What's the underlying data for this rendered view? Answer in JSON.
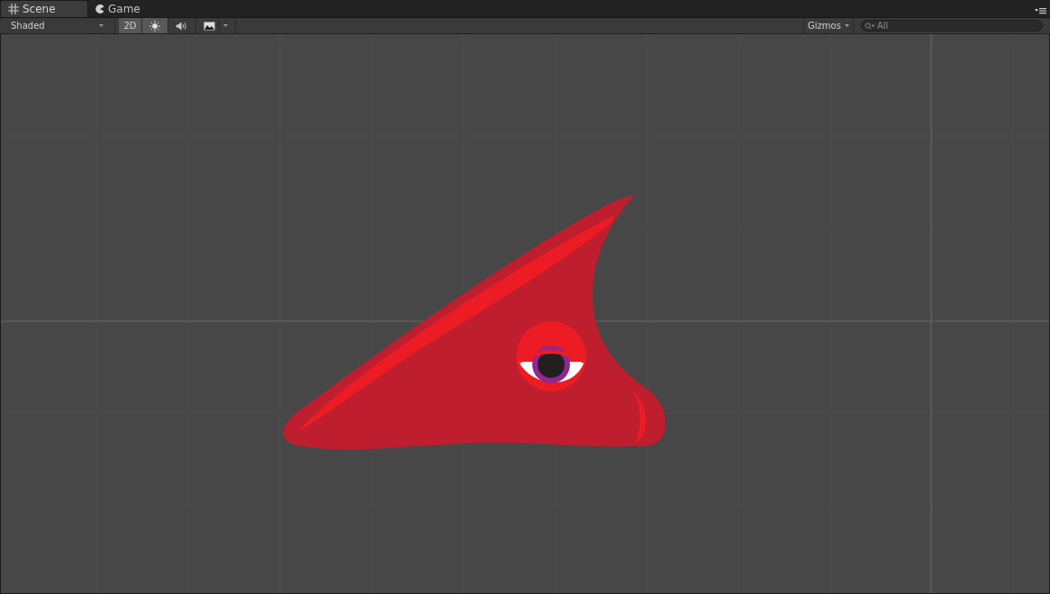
{
  "tabs": [
    {
      "label": "Scene",
      "kind": "scene",
      "selected": true
    },
    {
      "label": "Game",
      "kind": "game",
      "selected": false
    }
  ],
  "toolbar": {
    "shading": "Shaded",
    "toggles": [
      {
        "kind": "dimension",
        "label": "2D",
        "on": true
      },
      {
        "kind": "light",
        "on": true
      },
      {
        "kind": "audio",
        "on": false
      },
      {
        "kind": "effects",
        "on": false
      }
    ],
    "gizmos": "Gizmos",
    "search": {
      "placeholder": "All"
    }
  }
}
